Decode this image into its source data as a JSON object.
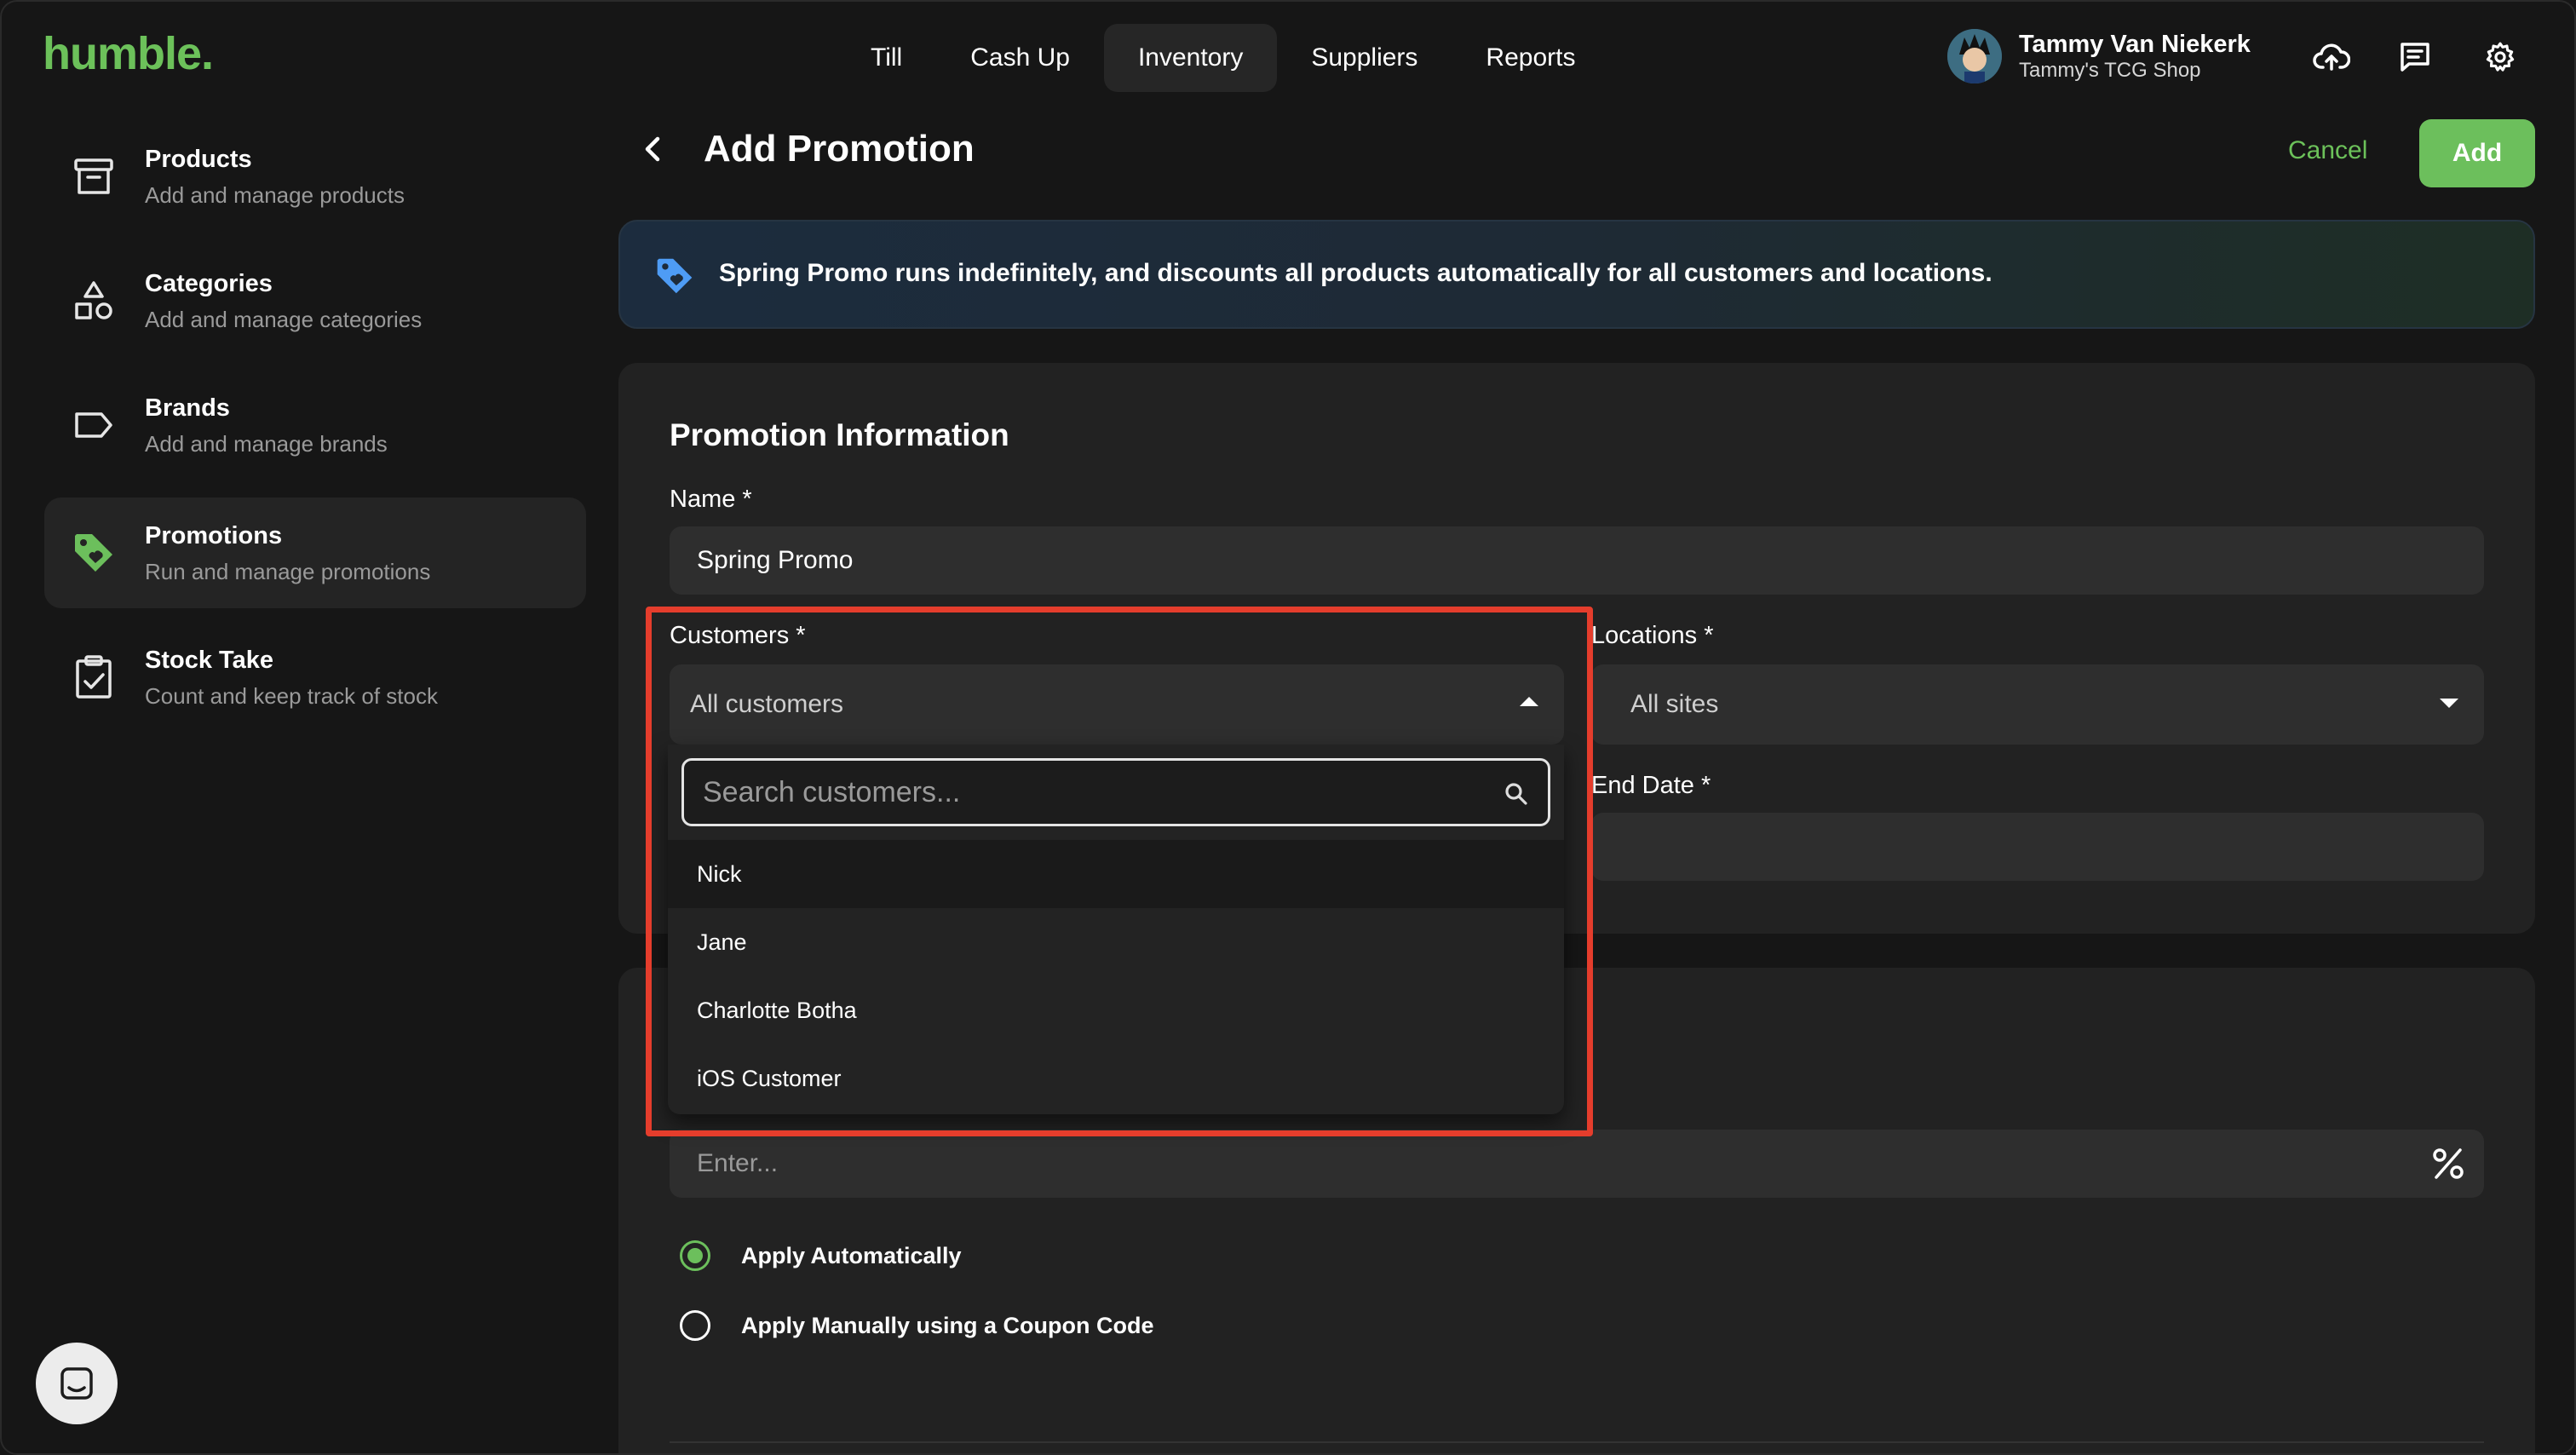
{
  "app": {
    "logo": "humble."
  },
  "nav": {
    "items": [
      {
        "label": "Till"
      },
      {
        "label": "Cash Up"
      },
      {
        "label": "Inventory",
        "active": true
      },
      {
        "label": "Suppliers"
      },
      {
        "label": "Reports"
      }
    ]
  },
  "user": {
    "name": "Tammy Van Niekerk",
    "shop": "Tammy's TCG Shop"
  },
  "top_icons": [
    "cloud-upload-icon",
    "chat-icon",
    "gear-icon"
  ],
  "sidebar": {
    "items": [
      {
        "title": "Products",
        "subtitle": "Add and manage products",
        "icon": "archive-box-icon"
      },
      {
        "title": "Categories",
        "subtitle": "Add and manage categories",
        "icon": "shapes-icon"
      },
      {
        "title": "Brands",
        "subtitle": "Add and manage brands",
        "icon": "label-tag-icon"
      },
      {
        "title": "Promotions",
        "subtitle": "Run and manage promotions",
        "icon": "promo-tag-icon",
        "active": true
      },
      {
        "title": "Stock Take",
        "subtitle": "Count and keep track of stock",
        "icon": "clipboard-check-icon"
      }
    ]
  },
  "header": {
    "title": "Add Promotion",
    "cancel_label": "Cancel",
    "add_label": "Add"
  },
  "banner": {
    "text": "Spring Promo runs indefinitely, and discounts all products automatically for all customers and locations."
  },
  "promotion_info": {
    "title": "Promotion Information",
    "name_label": "Name *",
    "name_value": "Spring Promo",
    "customers_label": "Customers *",
    "customers_value": "All customers",
    "locations_label": "Locations *",
    "locations_value": "All sites",
    "end_date_label": "End Date *"
  },
  "customer_dropdown": {
    "search_placeholder": "Search customers...",
    "options": [
      "Nick",
      "Jane",
      "Charlotte Botha",
      "iOS Customer"
    ]
  },
  "discount": {
    "placeholder": "Enter...",
    "unit_symbol": "%",
    "options": [
      {
        "label": "Apply Automatically",
        "selected": true
      },
      {
        "label": "Apply Manually using a Coupon Code",
        "selected": false
      }
    ]
  },
  "colors": {
    "accent": "#6cbf5c",
    "highlight": "#e53d2c",
    "background": "#161616",
    "card": "#222222"
  }
}
